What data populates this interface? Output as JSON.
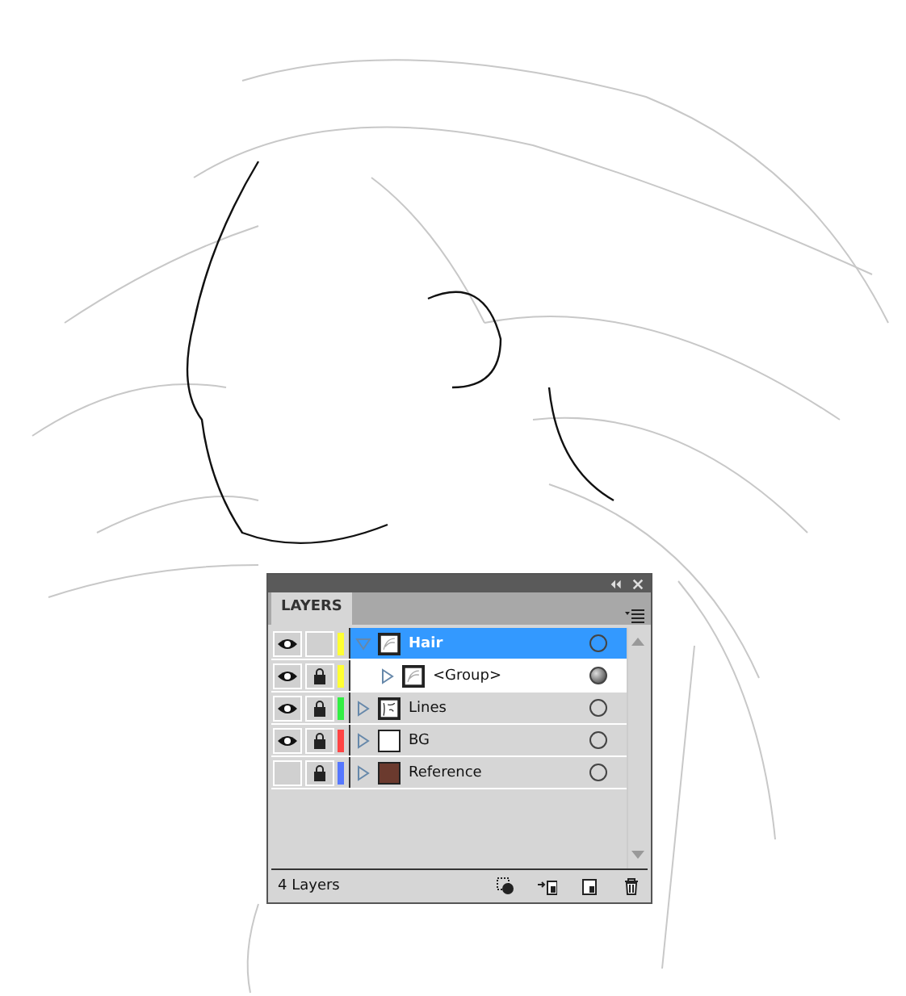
{
  "panel": {
    "tab": "LAYERS",
    "layers": [
      {
        "name": "Hair",
        "visible": true,
        "locked": false,
        "color": "#ffff33",
        "expanded": true,
        "selected": true,
        "targeted": false,
        "kind": "sketch",
        "children": [
          {
            "name": "<Group>",
            "visible": true,
            "locked": true,
            "color": "#ffff33",
            "expanded": false,
            "selected": false,
            "targeted": true,
            "kind": "sketch"
          }
        ]
      },
      {
        "name": "Lines",
        "visible": true,
        "locked": true,
        "color": "#33ee44",
        "expanded": false,
        "selected": false,
        "targeted": false,
        "kind": "lines"
      },
      {
        "name": "BG",
        "visible": true,
        "locked": true,
        "color": "#ff4444",
        "expanded": false,
        "selected": false,
        "targeted": false,
        "kind": "blank"
      },
      {
        "name": "Reference",
        "visible": false,
        "locked": true,
        "color": "#5577ff",
        "expanded": false,
        "selected": false,
        "targeted": false,
        "kind": "photo"
      }
    ],
    "footer": "4 Layers"
  }
}
